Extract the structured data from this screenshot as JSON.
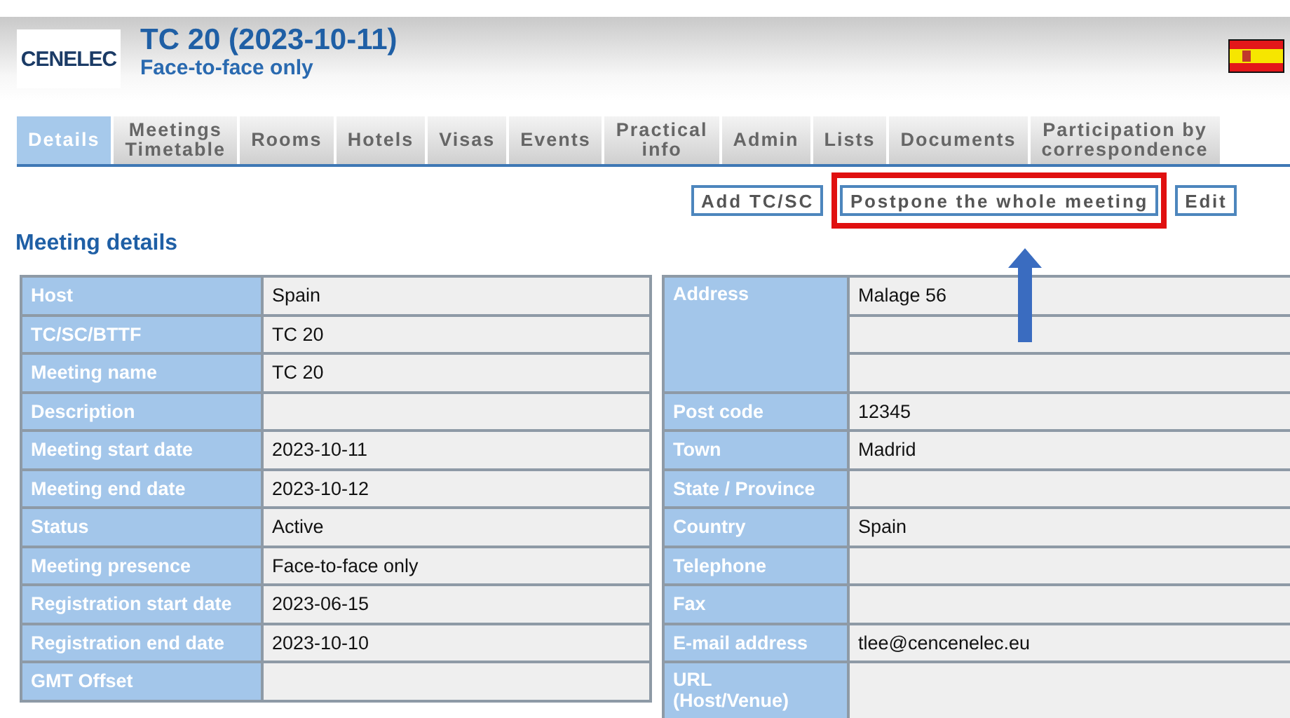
{
  "header": {
    "logo": "CENELEC",
    "title": "TC 20 (2023-10-11)",
    "subtitle": "Face-to-face only"
  },
  "tabs": [
    {
      "label": "Details",
      "selected": true
    },
    {
      "label": "Meetings\nTimetable",
      "selected": false
    },
    {
      "label": "Rooms",
      "selected": false
    },
    {
      "label": "Hotels",
      "selected": false
    },
    {
      "label": "Visas",
      "selected": false
    },
    {
      "label": "Events",
      "selected": false
    },
    {
      "label": "Practical\ninfo",
      "selected": false
    },
    {
      "label": "Admin",
      "selected": false
    },
    {
      "label": "Lists",
      "selected": false
    },
    {
      "label": "Documents",
      "selected": false
    },
    {
      "label": "Participation by\ncorrespondence",
      "selected": false
    }
  ],
  "actions": [
    {
      "label": "Add TC/SC",
      "highlighted": false
    },
    {
      "label": "Postpone the whole meeting",
      "highlighted": true
    },
    {
      "label": "Edit",
      "highlighted": false
    }
  ],
  "section_title": "Meeting details",
  "left_table": [
    {
      "label": "Host",
      "value": "Spain"
    },
    {
      "label": "TC/SC/BTTF",
      "value": "TC 20"
    },
    {
      "label": "Meeting name",
      "value": "TC 20"
    },
    {
      "label": "Description"
    },
    {
      "label": "Meeting start date",
      "value": "2023-10-11"
    },
    {
      "label": "Meeting end date",
      "value": "2023-10-12"
    },
    {
      "label": "Status",
      "value": "Active"
    },
    {
      "label": "Meeting presence",
      "value": "Face-to-face only"
    },
    {
      "label": "Registration start date",
      "value": "2023-06-15"
    },
    {
      "label": "Registration end date",
      "value": "2023-10-10"
    },
    {
      "label": "GMT Offset"
    }
  ],
  "right_table": [
    {
      "label": "Address",
      "value": "Malage 56",
      "kind": "multiline"
    },
    {
      "label": "Post code",
      "value": "12345",
      "kind": "single"
    },
    {
      "label": "Town",
      "value": "Madrid",
      "kind": "single"
    },
    {
      "label": "State / Province",
      "kind": "single"
    },
    {
      "label": "Country",
      "value": "Spain",
      "kind": "single"
    },
    {
      "label": "Telephone",
      "kind": "single"
    },
    {
      "label": "Fax",
      "kind": "single"
    },
    {
      "label": "E-mail address",
      "value": "tlee@cencenelec.eu",
      "kind": "single"
    },
    {
      "label": "URL\n(Host/Venue)",
      "kind": "tall"
    }
  ]
}
